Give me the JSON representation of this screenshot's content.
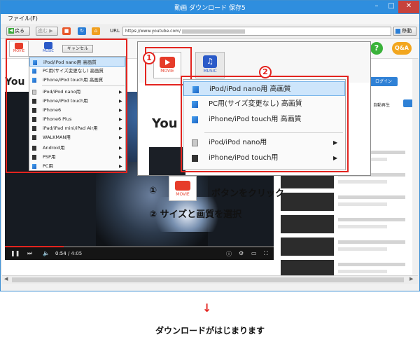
{
  "window": {
    "title": "動画 ダウンロード 保存5",
    "min_label": "–",
    "max_label": "□",
    "close_label": "✕"
  },
  "menubar": {
    "file": "ファイル(F)"
  },
  "navbar": {
    "back": "戻る",
    "forward": "進む",
    "url_label": "URL",
    "url_value": "https://www.youtube.com/",
    "go_label": "移動"
  },
  "toolbar": {
    "movie": "MOVIE",
    "music": "MUSIC",
    "cancel": "キャンセル",
    "help": "?",
    "qa": "Q&A"
  },
  "browser": {
    "logo_text": "You",
    "login_label": "ログイン",
    "autoplay_label": "自動再生"
  },
  "player": {
    "time_current": "0:54",
    "time_total": " / 4:05",
    "progress": 0.22,
    "play_icon": "❚❚",
    "next_icon": "⏭",
    "volume_icon": "🔈",
    "info_icon": "ⓘ",
    "settings_icon": "⚙",
    "size_icon": "▭",
    "fullscreen_icon": "⛶"
  },
  "mini_menu": {
    "items": [
      {
        "label": "iPod/iPod nano用 高画質",
        "icon": "blue",
        "arrow": ""
      },
      {
        "label": "PC用(サイズ変更なし) 高画質",
        "icon": "blue",
        "arrow": ""
      },
      {
        "label": "iPhone/iPod touch用 高画質",
        "icon": "blue",
        "arrow": ""
      },
      {
        "label": "iPod/iPod nano用",
        "icon": "gray",
        "arrow": "▶"
      },
      {
        "label": "iPhone/iPod touch用",
        "icon": "black",
        "arrow": "▶"
      },
      {
        "label": "iPhone6",
        "icon": "black",
        "arrow": "▶"
      },
      {
        "label": "iPhone6 Plus",
        "icon": "black",
        "arrow": "▶"
      },
      {
        "label": "iPad/iPad mini/iPad Air用",
        "icon": "black",
        "arrow": "▶"
      },
      {
        "label": "WALKMAN用",
        "icon": "black",
        "arrow": "▶"
      },
      {
        "label": "Android用",
        "icon": "black",
        "arrow": "▶"
      },
      {
        "label": "PSP用",
        "icon": "black",
        "arrow": "▶"
      },
      {
        "label": "PC用",
        "icon": "blue",
        "arrow": "▶"
      }
    ]
  },
  "zoom": {
    "movie": "MOVIE",
    "music": "MUSIC",
    "logo_text": "You",
    "num1": "1",
    "num2": "2",
    "items": [
      {
        "label": "iPod/iPod nano用 高画質",
        "icon": "blue",
        "arrow": ""
      },
      {
        "label": "PC用(サイズ変更なし) 高画質",
        "icon": "blue",
        "arrow": ""
      },
      {
        "label": "iPhone/iPod touch用 高画質",
        "icon": "blue",
        "arrow": ""
      },
      {
        "label": "iPod/iPod nano用",
        "icon": "gray",
        "arrow": "▶"
      },
      {
        "label": "iPhone/iPod touch用",
        "icon": "black",
        "arrow": "▶"
      }
    ]
  },
  "instructions": {
    "step1_num": "①",
    "step1_button": "MOVIE",
    "step1_text": "ボタンをクリック",
    "step2": "② サイズと画質を選択"
  },
  "footer": {
    "arrow": "↓",
    "text": "ダウンロードがはじまります"
  },
  "colors": {
    "titlebar": "#2f8ede",
    "highlight": "#e3241f",
    "selected": "#cde5fb",
    "movie_red": "#e63c2a",
    "music_blue": "#2b5ac8"
  }
}
